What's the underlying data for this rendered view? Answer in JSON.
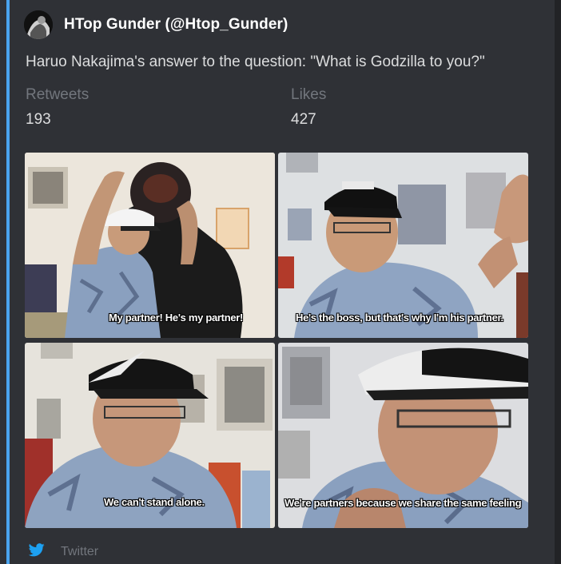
{
  "embed": {
    "accent_color": "#4aa3ee",
    "author": {
      "name": "HTop Gunder (@Htop_Gunder)"
    },
    "description": "Haruo Nakajima's answer to the question: \"What is Godzilla to you?\"",
    "fields": [
      {
        "name": "Retweets",
        "value": "193"
      },
      {
        "name": "Likes",
        "value": "427"
      }
    ],
    "images": [
      {
        "caption": "My partner! He's my partner!"
      },
      {
        "caption": "He's the boss, but that's why I'm his partner."
      },
      {
        "caption": "We can't stand alone."
      },
      {
        "caption": "We're partners because we share the same feeling"
      }
    ],
    "footer": {
      "icon": "twitter-bird-icon",
      "text": "Twitter"
    }
  }
}
